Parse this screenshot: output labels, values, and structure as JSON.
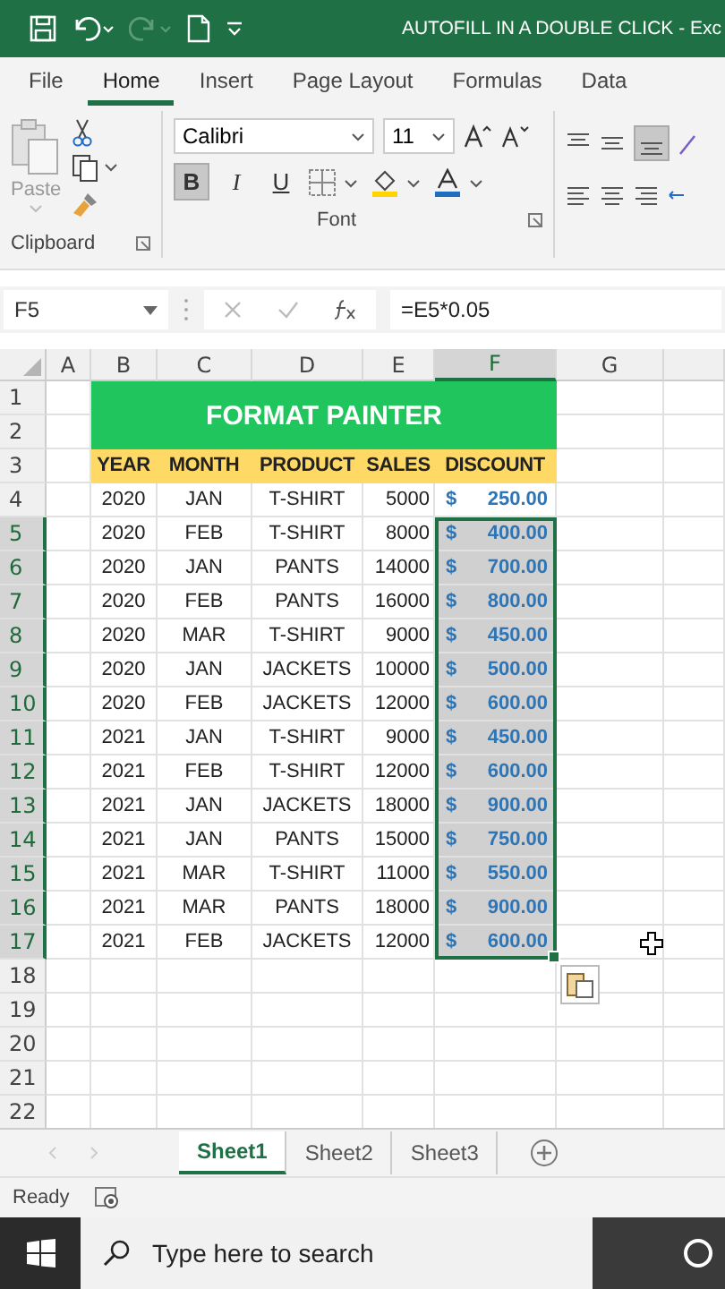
{
  "title_bar": {
    "title": "AUTOFILL IN A DOUBLE CLICK  -  Exc"
  },
  "menu_tabs": [
    {
      "label": "File",
      "selected": false
    },
    {
      "label": "Home",
      "selected": true
    },
    {
      "label": "Insert",
      "selected": false
    },
    {
      "label": "Page Layout",
      "selected": false
    },
    {
      "label": "Formulas",
      "selected": false
    },
    {
      "label": "Data",
      "selected": false
    }
  ],
  "ribbon": {
    "paste_label": "Paste",
    "font_name": "Calibri",
    "font_size": "11",
    "bold": {
      "label": "B",
      "selected": true
    },
    "italic": {
      "label": "I",
      "selected": false
    },
    "underline": {
      "label": "U",
      "selected": false
    },
    "align_bottom": {
      "selected": true
    },
    "groups": [
      "Clipboard",
      "Font"
    ]
  },
  "formula_bar": {
    "name_box": "F5",
    "formula": "=E5*0.05"
  },
  "sheet": {
    "columns": [
      {
        "label": "A",
        "selected": false
      },
      {
        "label": "B",
        "selected": false
      },
      {
        "label": "C",
        "selected": false
      },
      {
        "label": "D",
        "selected": false
      },
      {
        "label": "E",
        "selected": false
      },
      {
        "label": "F",
        "selected": true
      },
      {
        "label": "G",
        "selected": false
      }
    ],
    "row_numbers": [
      "1",
      "2",
      "3",
      "4",
      "5",
      "6",
      "7",
      "8",
      "9",
      "10",
      "11",
      "12",
      "13",
      "14",
      "15",
      "16",
      "17",
      "18",
      "19",
      "20",
      "21",
      "22"
    ],
    "title": "FORMAT PAINTER",
    "headers": [
      "YEAR",
      "MONTH",
      "PRODUCT",
      "SALES",
      "DISCOUNT"
    ],
    "rows": [
      {
        "cells": [
          "",
          "2020",
          "JAN",
          "T-SHIRT",
          "5000"
        ],
        "discount": {
          "currency": "$",
          "amount": "250.00"
        },
        "selected": false
      },
      {
        "cells": [
          "",
          "2020",
          "FEB",
          "T-SHIRT",
          "8000"
        ],
        "discount": {
          "currency": "$",
          "amount": "400.00"
        },
        "selected": true
      },
      {
        "cells": [
          "",
          "2020",
          "JAN",
          "PANTS",
          "14000"
        ],
        "discount": {
          "currency": "$",
          "amount": "700.00"
        },
        "selected": true
      },
      {
        "cells": [
          "",
          "2020",
          "FEB",
          "PANTS",
          "16000"
        ],
        "discount": {
          "currency": "$",
          "amount": "800.00"
        },
        "selected": true
      },
      {
        "cells": [
          "",
          "2020",
          "MAR",
          "T-SHIRT",
          "9000"
        ],
        "discount": {
          "currency": "$",
          "amount": "450.00"
        },
        "selected": true
      },
      {
        "cells": [
          "",
          "2020",
          "JAN",
          "JACKETS",
          "10000"
        ],
        "discount": {
          "currency": "$",
          "amount": "500.00"
        },
        "selected": true
      },
      {
        "cells": [
          "",
          "2020",
          "FEB",
          "JACKETS",
          "12000"
        ],
        "discount": {
          "currency": "$",
          "amount": "600.00"
        },
        "selected": true
      },
      {
        "cells": [
          "",
          "2021",
          "JAN",
          "T-SHIRT",
          "9000"
        ],
        "discount": {
          "currency": "$",
          "amount": "450.00"
        },
        "selected": true
      },
      {
        "cells": [
          "",
          "2021",
          "FEB",
          "T-SHIRT",
          "12000"
        ],
        "discount": {
          "currency": "$",
          "amount": "600.00"
        },
        "selected": true
      },
      {
        "cells": [
          "",
          "2021",
          "JAN",
          "JACKETS",
          "18000"
        ],
        "discount": {
          "currency": "$",
          "amount": "900.00"
        },
        "selected": true
      },
      {
        "cells": [
          "",
          "2021",
          "JAN",
          "PANTS",
          "15000"
        ],
        "discount": {
          "currency": "$",
          "amount": "750.00"
        },
        "selected": true
      },
      {
        "cells": [
          "",
          "2021",
          "MAR",
          "T-SHIRT",
          "11000"
        ],
        "discount": {
          "currency": "$",
          "amount": "550.00"
        },
        "selected": true
      },
      {
        "cells": [
          "",
          "2021",
          "MAR",
          "PANTS",
          "18000"
        ],
        "discount": {
          "currency": "$",
          "amount": "900.00"
        },
        "selected": true
      },
      {
        "cells": [
          "",
          "2021",
          "FEB",
          "JACKETS",
          "12000"
        ],
        "discount": {
          "currency": "$",
          "amount": "600.00"
        },
        "selected": true
      }
    ]
  },
  "sheet_tabs": [
    {
      "label": "Sheet1",
      "selected": true
    },
    {
      "label": "Sheet2",
      "selected": false
    },
    {
      "label": "Sheet3",
      "selected": false
    }
  ],
  "status_bar": {
    "text": "Ready"
  },
  "taskbar": {
    "search": {
      "placeholder": "Type here to search"
    }
  }
}
